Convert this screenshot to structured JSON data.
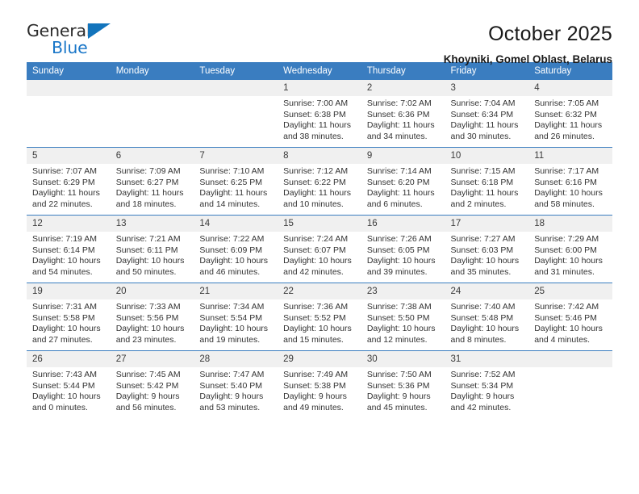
{
  "brand": {
    "name_top": "General",
    "name_bottom": "Blue",
    "triangle_color": "#1274bc",
    "text_color": "#2b2b2b",
    "blue_color": "#1976c8"
  },
  "header": {
    "title": "October 2025",
    "subtitle": "Khoyniki, Gomel Oblast, Belarus"
  },
  "theme": {
    "header_row_bg": "#3a7dc0",
    "header_row_text": "#ffffff",
    "daynum_bg": "#f0f0f0",
    "row_divider": "#3a7dc0"
  },
  "weekday_headers": [
    "Sunday",
    "Monday",
    "Tuesday",
    "Wednesday",
    "Thursday",
    "Friday",
    "Saturday"
  ],
  "weeks": [
    [
      {
        "day": "",
        "sunrise": "",
        "sunset": "",
        "daylight_line1": "",
        "daylight_line2": ""
      },
      {
        "day": "",
        "sunrise": "",
        "sunset": "",
        "daylight_line1": "",
        "daylight_line2": ""
      },
      {
        "day": "",
        "sunrise": "",
        "sunset": "",
        "daylight_line1": "",
        "daylight_line2": ""
      },
      {
        "day": "1",
        "sunrise": "Sunrise: 7:00 AM",
        "sunset": "Sunset: 6:38 PM",
        "daylight_line1": "Daylight: 11 hours",
        "daylight_line2": "and 38 minutes."
      },
      {
        "day": "2",
        "sunrise": "Sunrise: 7:02 AM",
        "sunset": "Sunset: 6:36 PM",
        "daylight_line1": "Daylight: 11 hours",
        "daylight_line2": "and 34 minutes."
      },
      {
        "day": "3",
        "sunrise": "Sunrise: 7:04 AM",
        "sunset": "Sunset: 6:34 PM",
        "daylight_line1": "Daylight: 11 hours",
        "daylight_line2": "and 30 minutes."
      },
      {
        "day": "4",
        "sunrise": "Sunrise: 7:05 AM",
        "sunset": "Sunset: 6:32 PM",
        "daylight_line1": "Daylight: 11 hours",
        "daylight_line2": "and 26 minutes."
      }
    ],
    [
      {
        "day": "5",
        "sunrise": "Sunrise: 7:07 AM",
        "sunset": "Sunset: 6:29 PM",
        "daylight_line1": "Daylight: 11 hours",
        "daylight_line2": "and 22 minutes."
      },
      {
        "day": "6",
        "sunrise": "Sunrise: 7:09 AM",
        "sunset": "Sunset: 6:27 PM",
        "daylight_line1": "Daylight: 11 hours",
        "daylight_line2": "and 18 minutes."
      },
      {
        "day": "7",
        "sunrise": "Sunrise: 7:10 AM",
        "sunset": "Sunset: 6:25 PM",
        "daylight_line1": "Daylight: 11 hours",
        "daylight_line2": "and 14 minutes."
      },
      {
        "day": "8",
        "sunrise": "Sunrise: 7:12 AM",
        "sunset": "Sunset: 6:22 PM",
        "daylight_line1": "Daylight: 11 hours",
        "daylight_line2": "and 10 minutes."
      },
      {
        "day": "9",
        "sunrise": "Sunrise: 7:14 AM",
        "sunset": "Sunset: 6:20 PM",
        "daylight_line1": "Daylight: 11 hours",
        "daylight_line2": "and 6 minutes."
      },
      {
        "day": "10",
        "sunrise": "Sunrise: 7:15 AM",
        "sunset": "Sunset: 6:18 PM",
        "daylight_line1": "Daylight: 11 hours",
        "daylight_line2": "and 2 minutes."
      },
      {
        "day": "11",
        "sunrise": "Sunrise: 7:17 AM",
        "sunset": "Sunset: 6:16 PM",
        "daylight_line1": "Daylight: 10 hours",
        "daylight_line2": "and 58 minutes."
      }
    ],
    [
      {
        "day": "12",
        "sunrise": "Sunrise: 7:19 AM",
        "sunset": "Sunset: 6:14 PM",
        "daylight_line1": "Daylight: 10 hours",
        "daylight_line2": "and 54 minutes."
      },
      {
        "day": "13",
        "sunrise": "Sunrise: 7:21 AM",
        "sunset": "Sunset: 6:11 PM",
        "daylight_line1": "Daylight: 10 hours",
        "daylight_line2": "and 50 minutes."
      },
      {
        "day": "14",
        "sunrise": "Sunrise: 7:22 AM",
        "sunset": "Sunset: 6:09 PM",
        "daylight_line1": "Daylight: 10 hours",
        "daylight_line2": "and 46 minutes."
      },
      {
        "day": "15",
        "sunrise": "Sunrise: 7:24 AM",
        "sunset": "Sunset: 6:07 PM",
        "daylight_line1": "Daylight: 10 hours",
        "daylight_line2": "and 42 minutes."
      },
      {
        "day": "16",
        "sunrise": "Sunrise: 7:26 AM",
        "sunset": "Sunset: 6:05 PM",
        "daylight_line1": "Daylight: 10 hours",
        "daylight_line2": "and 39 minutes."
      },
      {
        "day": "17",
        "sunrise": "Sunrise: 7:27 AM",
        "sunset": "Sunset: 6:03 PM",
        "daylight_line1": "Daylight: 10 hours",
        "daylight_line2": "and 35 minutes."
      },
      {
        "day": "18",
        "sunrise": "Sunrise: 7:29 AM",
        "sunset": "Sunset: 6:00 PM",
        "daylight_line1": "Daylight: 10 hours",
        "daylight_line2": "and 31 minutes."
      }
    ],
    [
      {
        "day": "19",
        "sunrise": "Sunrise: 7:31 AM",
        "sunset": "Sunset: 5:58 PM",
        "daylight_line1": "Daylight: 10 hours",
        "daylight_line2": "and 27 minutes."
      },
      {
        "day": "20",
        "sunrise": "Sunrise: 7:33 AM",
        "sunset": "Sunset: 5:56 PM",
        "daylight_line1": "Daylight: 10 hours",
        "daylight_line2": "and 23 minutes."
      },
      {
        "day": "21",
        "sunrise": "Sunrise: 7:34 AM",
        "sunset": "Sunset: 5:54 PM",
        "daylight_line1": "Daylight: 10 hours",
        "daylight_line2": "and 19 minutes."
      },
      {
        "day": "22",
        "sunrise": "Sunrise: 7:36 AM",
        "sunset": "Sunset: 5:52 PM",
        "daylight_line1": "Daylight: 10 hours",
        "daylight_line2": "and 15 minutes."
      },
      {
        "day": "23",
        "sunrise": "Sunrise: 7:38 AM",
        "sunset": "Sunset: 5:50 PM",
        "daylight_line1": "Daylight: 10 hours",
        "daylight_line2": "and 12 minutes."
      },
      {
        "day": "24",
        "sunrise": "Sunrise: 7:40 AM",
        "sunset": "Sunset: 5:48 PM",
        "daylight_line1": "Daylight: 10 hours",
        "daylight_line2": "and 8 minutes."
      },
      {
        "day": "25",
        "sunrise": "Sunrise: 7:42 AM",
        "sunset": "Sunset: 5:46 PM",
        "daylight_line1": "Daylight: 10 hours",
        "daylight_line2": "and 4 minutes."
      }
    ],
    [
      {
        "day": "26",
        "sunrise": "Sunrise: 7:43 AM",
        "sunset": "Sunset: 5:44 PM",
        "daylight_line1": "Daylight: 10 hours",
        "daylight_line2": "and 0 minutes."
      },
      {
        "day": "27",
        "sunrise": "Sunrise: 7:45 AM",
        "sunset": "Sunset: 5:42 PM",
        "daylight_line1": "Daylight: 9 hours",
        "daylight_line2": "and 56 minutes."
      },
      {
        "day": "28",
        "sunrise": "Sunrise: 7:47 AM",
        "sunset": "Sunset: 5:40 PM",
        "daylight_line1": "Daylight: 9 hours",
        "daylight_line2": "and 53 minutes."
      },
      {
        "day": "29",
        "sunrise": "Sunrise: 7:49 AM",
        "sunset": "Sunset: 5:38 PM",
        "daylight_line1": "Daylight: 9 hours",
        "daylight_line2": "and 49 minutes."
      },
      {
        "day": "30",
        "sunrise": "Sunrise: 7:50 AM",
        "sunset": "Sunset: 5:36 PM",
        "daylight_line1": "Daylight: 9 hours",
        "daylight_line2": "and 45 minutes."
      },
      {
        "day": "31",
        "sunrise": "Sunrise: 7:52 AM",
        "sunset": "Sunset: 5:34 PM",
        "daylight_line1": "Daylight: 9 hours",
        "daylight_line2": "and 42 minutes."
      },
      {
        "day": "",
        "sunrise": "",
        "sunset": "",
        "daylight_line1": "",
        "daylight_line2": ""
      }
    ]
  ]
}
